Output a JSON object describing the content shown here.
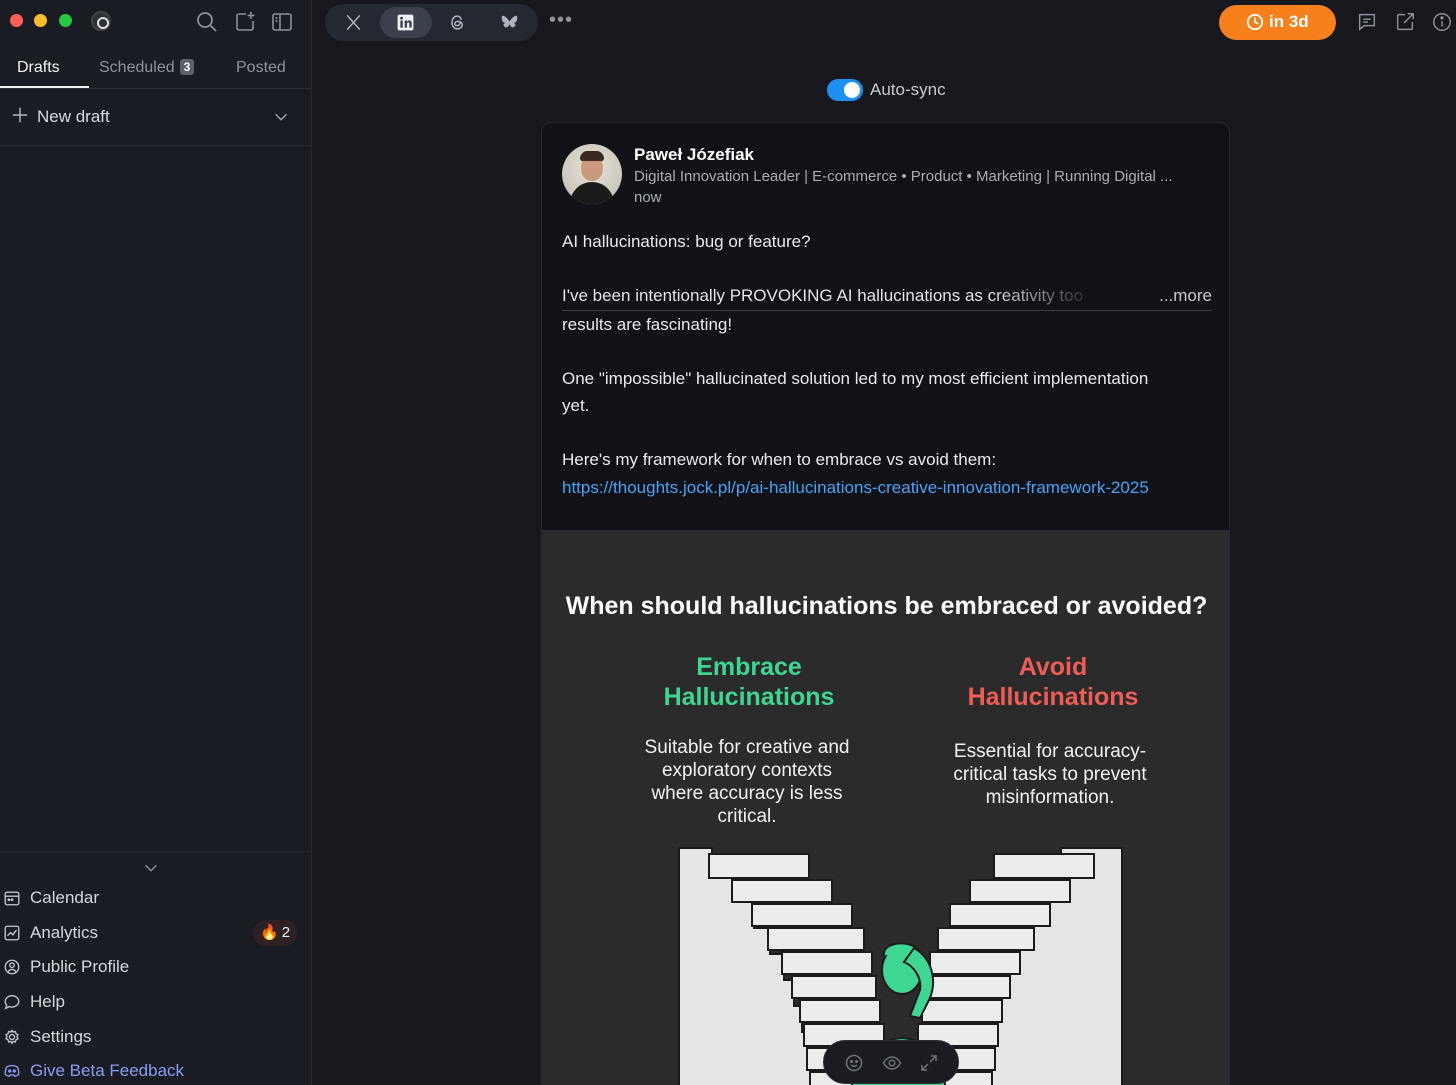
{
  "sidebar": {
    "tabs": [
      {
        "label": "Drafts"
      },
      {
        "label": "Scheduled",
        "count": "3"
      },
      {
        "label": "Posted"
      }
    ],
    "new_draft_label": "New draft",
    "nav": [
      {
        "label": "Calendar",
        "icon": "calendar-icon"
      },
      {
        "label": "Analytics",
        "icon": "analytics-icon",
        "badge": "2"
      },
      {
        "label": "Public Profile",
        "icon": "profile-icon"
      },
      {
        "label": "Help",
        "icon": "chat-bubble-icon"
      },
      {
        "label": "Settings",
        "icon": "gear-icon"
      },
      {
        "label": "Give Beta Feedback",
        "icon": "discord-icon"
      }
    ]
  },
  "topbar": {
    "platforms": [
      "X",
      "LinkedIn",
      "Threads",
      "Bluesky"
    ],
    "active_platform": "LinkedIn",
    "schedule_label": "in 3d"
  },
  "autosync": {
    "label": "Auto-sync",
    "enabled": true
  },
  "post": {
    "author": "Paweł Józefiak",
    "headline": "Digital Innovation Leader | E-commerce • Product • Marketing | Running Digital ...",
    "time": "now",
    "lines": {
      "l1": "AI hallucinations: bug or feature?",
      "l2": "I've been intentionally PROVOKING AI hallucinations as creativity too",
      "more": "...more",
      "l3": "results are fascinating!",
      "l4": "One \"impossible\" hallucinated solution led to my most efficient implementation",
      "l5": "yet.",
      "l6": "Here's my framework for when to embrace vs avoid them:",
      "link": "https://thoughts.jock.pl/p/ai-hallucinations-creative-innovation-framework-2025"
    }
  },
  "infographic": {
    "title": "When should hallucinations be embraced or avoided?",
    "embrace_title_1": "Embrace",
    "embrace_title_2": "Hallucinations",
    "embrace_desc": "Suitable for creative and exploratory contexts where accuracy is less critical.",
    "avoid_title_1": "Avoid",
    "avoid_title_2": "Hallucinations",
    "avoid_desc": "Essential for accuracy-critical tasks to prevent misinformation.",
    "colors": {
      "embrace": "#3fd592",
      "avoid": "#ee5d56"
    }
  }
}
